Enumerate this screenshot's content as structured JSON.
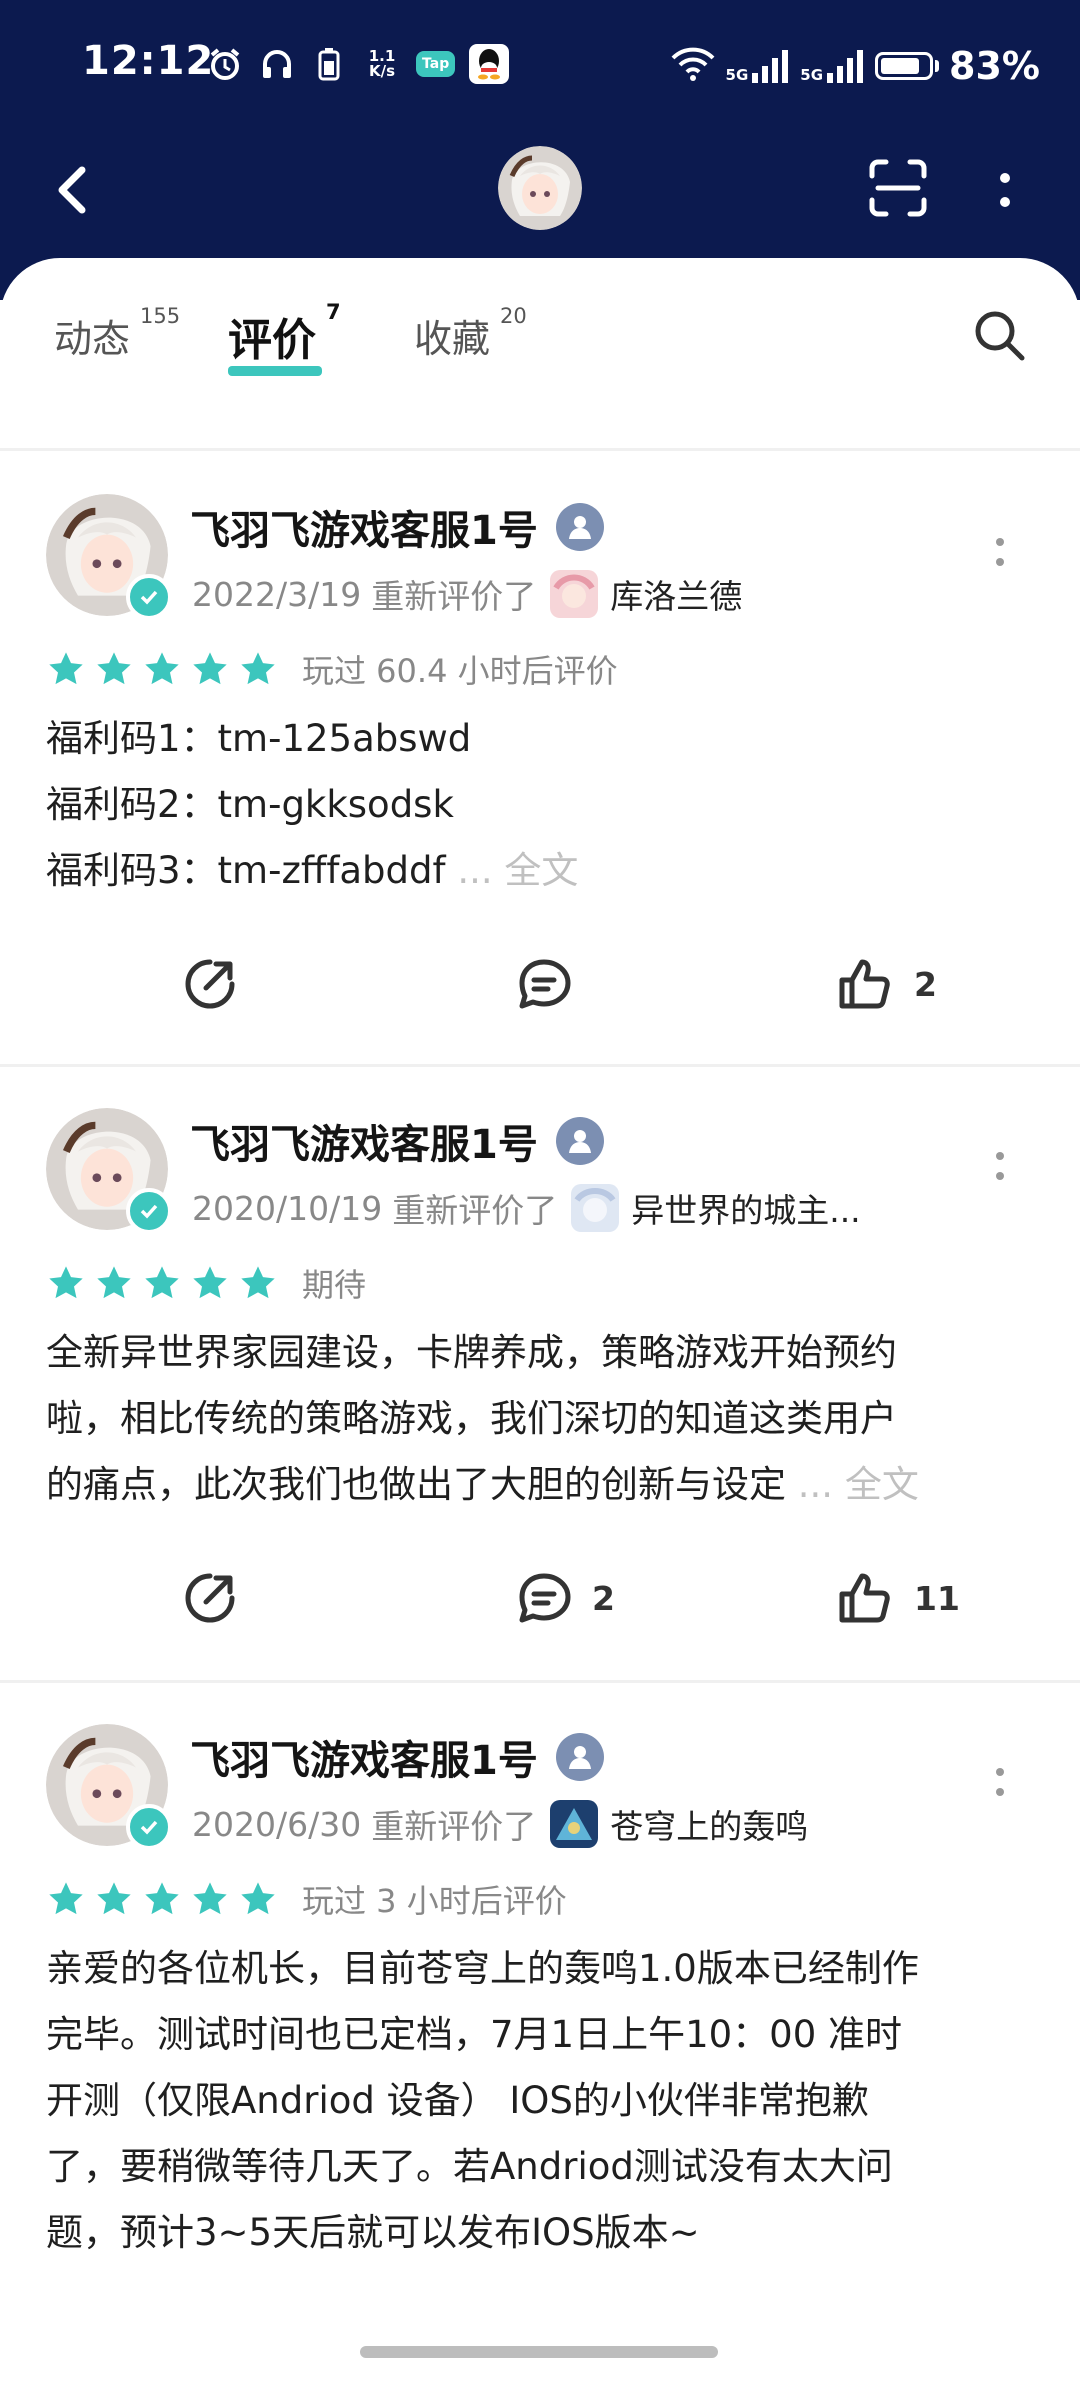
{
  "status_bar": {
    "time": "12:12",
    "net_speed_top": "1.1",
    "net_speed_bottom": "K/s",
    "tap_badge": "Tap",
    "sig1": "5G",
    "sig2": "5G",
    "battery": "83%"
  },
  "tabs": [
    {
      "label": "动态",
      "count": "155",
      "active": false
    },
    {
      "label": "评价",
      "count": "7",
      "active": true
    },
    {
      "label": "收藏",
      "count": "20",
      "active": false
    }
  ],
  "reviews": [
    {
      "username": "飞羽飞游戏客服1号",
      "date": "2022/3/19",
      "action": "重新评价了",
      "game": "库洛兰德",
      "stars": 5,
      "rating_text": "玩过 60.4 小时后评价",
      "lines": [
        "福利码1：tm-125abswd",
        "福利码2：tm-gkksodsk",
        "福利码3：tm-zfffabddf"
      ],
      "ellipsis": "...",
      "full_text_label": "全文",
      "comment_count": "",
      "like_count": "2"
    },
    {
      "username": "飞羽飞游戏客服1号",
      "date": "2020/10/19",
      "action": "重新评价了",
      "game": "异世界的城主...",
      "stars": 5,
      "rating_text": "期待",
      "lines": [
        "全新异世界家园建设，卡牌养成，策略游戏开始预约",
        "啦，相比传统的策略游戏，我们深切的知道这类用户",
        "的痛点，此次我们也做出了大胆的创新与设定"
      ],
      "ellipsis": "...",
      "full_text_label": "全文",
      "comment_count": "2",
      "like_count": "11"
    },
    {
      "username": "飞羽飞游戏客服1号",
      "date": "2020/6/30",
      "action": "重新评价了",
      "game": "苍穹上的轰鸣",
      "stars": 5,
      "rating_text": "玩过 3 小时后评价",
      "lines": [
        "亲爱的各位机长，目前苍穹上的轰鸣1.0版本已经制作",
        "完毕。测试时间也已定档，7月1日上午10：00 准时",
        "开测（仅限Andriod 设备） IOS的小伙伴非常抱歉",
        "了，要稍微等待几天了。若Andriod测试没有太大问",
        "题，预计3~5天后就可以发布IOS版本~"
      ]
    }
  ],
  "colors": {
    "header_bg": "#0c1a4f",
    "accent": "#3cc6bd",
    "badge": "#7c8fb2"
  }
}
